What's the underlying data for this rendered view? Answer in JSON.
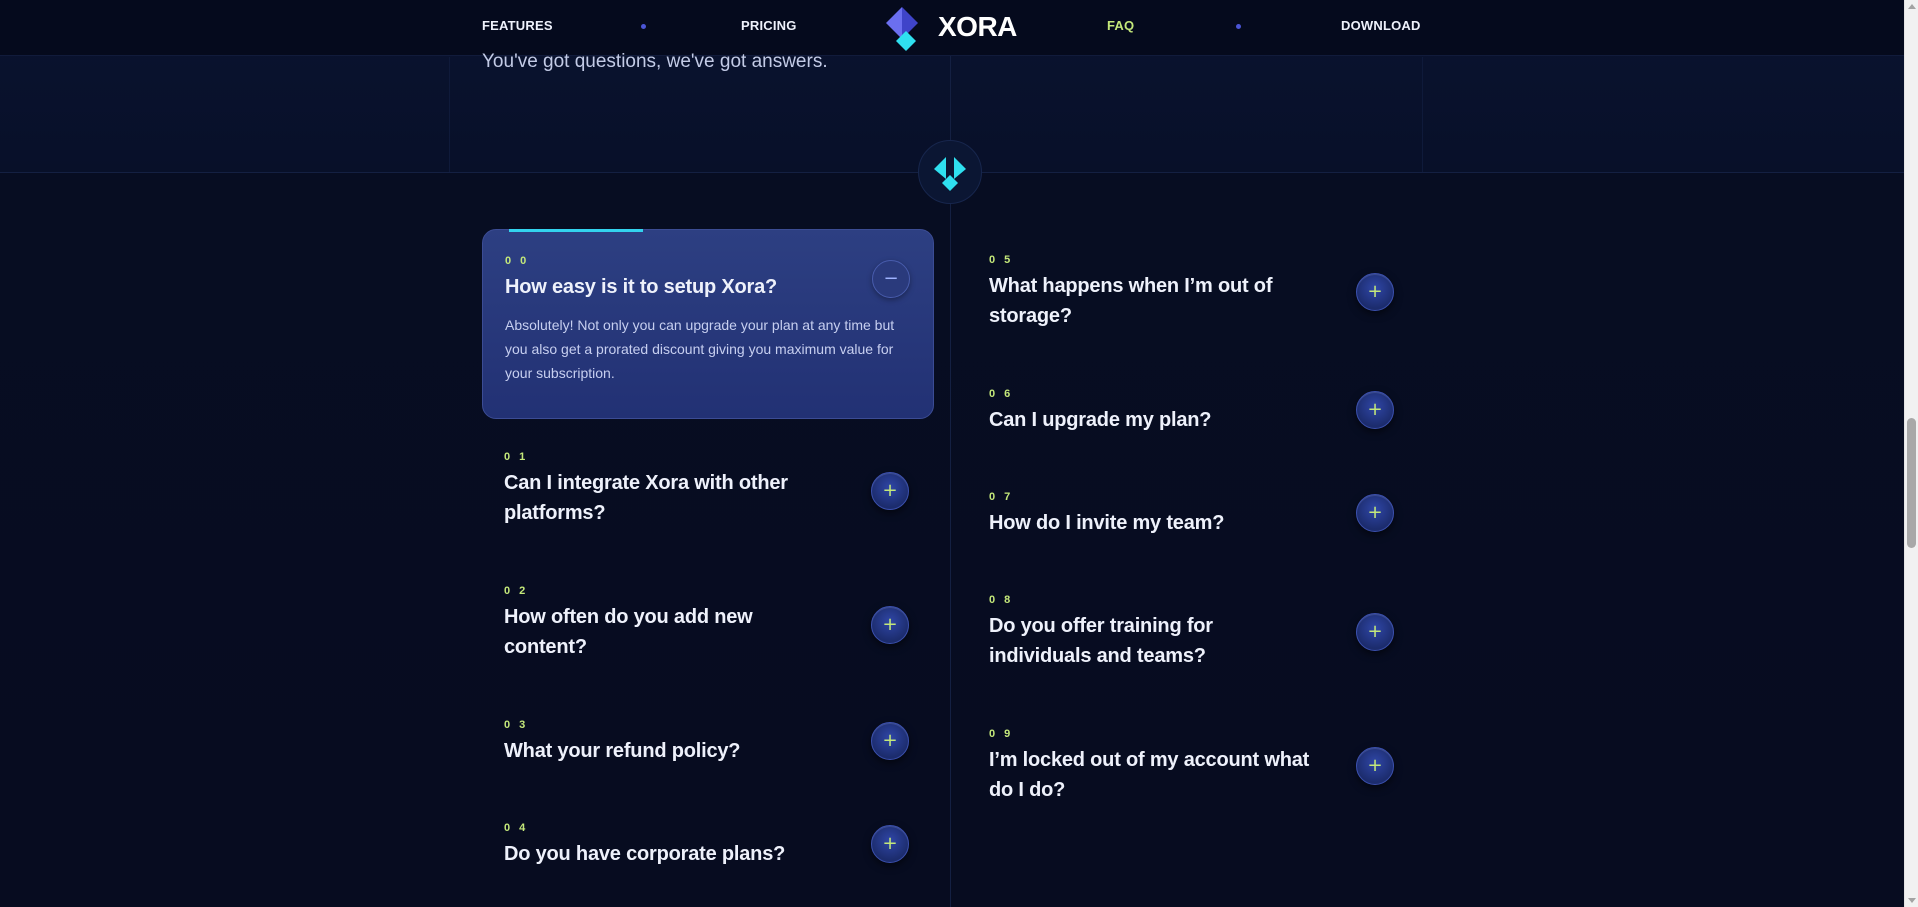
{
  "nav": {
    "links": [
      "FEATURES",
      "PRICING",
      "FAQ",
      "DOWNLOAD"
    ],
    "brand": "XORA",
    "active": "FAQ"
  },
  "subtitle": "You've got questions, we've got answers.",
  "colors": {
    "accent": "#c4e87a",
    "cyan": "#33d3ef",
    "brand_blue": "#4b55d6",
    "background": "#070d22"
  },
  "icons": {
    "logo": "xora-logo-icon",
    "plus": "plus-icon",
    "minus": "minus-icon"
  },
  "faq": {
    "left": [
      {
        "number": "0 0",
        "question": "How easy is it to setup Xora?",
        "answer": "Absolutely! Not only you can upgrade your plan at any time but you also get a prorated discount giving you maximum value for your subscription.",
        "expanded": true,
        "toggle": "−"
      },
      {
        "number": "0 1",
        "question": "Can I integrate Xora with other platforms?",
        "toggle": "+"
      },
      {
        "number": "0 2",
        "question": "How often do you add new content?",
        "toggle": "+"
      },
      {
        "number": "0 3",
        "question": "What your refund policy?",
        "toggle": "+"
      },
      {
        "number": "0 4",
        "question": "Do you have corporate plans?",
        "toggle": "+"
      }
    ],
    "right": [
      {
        "number": "0 5",
        "question": "What happens when I’m out of storage?",
        "toggle": "+"
      },
      {
        "number": "0 6",
        "question": "Can I upgrade my plan?",
        "toggle": "+"
      },
      {
        "number": "0 7",
        "question": "How do I invite my team?",
        "toggle": "+"
      },
      {
        "number": "0 8",
        "question": "Do you offer training for individuals and teams?",
        "toggle": "+"
      },
      {
        "number": "0 9",
        "question": "I’m locked out of my account what do I do?",
        "toggle": "+"
      }
    ]
  }
}
